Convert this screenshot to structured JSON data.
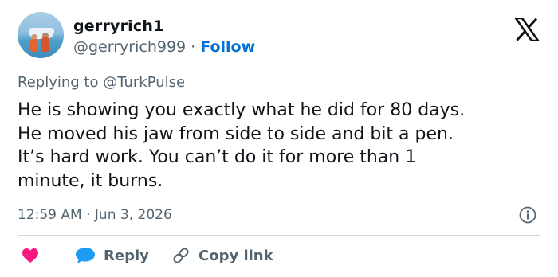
{
  "user": {
    "display_name": "gerryrich1",
    "handle": "@gerryrich999",
    "separator": " · ",
    "follow_label": "Follow"
  },
  "reply": {
    "prefix": "Replying to ",
    "target": "@TurkPulse"
  },
  "tweet": {
    "lines": [
      "He is showing you exactly what he did for 80 days.",
      "He moved his jaw from side to side and bit a pen.",
      "It’s hard work. You can’t do it for more than 1",
      "minute, it burns."
    ]
  },
  "meta": {
    "time": "12:59 AM",
    "separator": " · ",
    "date": "Jun 3, 2026"
  },
  "actions": {
    "reply_label": "Reply",
    "copy_label": "Copy link"
  },
  "icons": {
    "logo": "x-logo-icon",
    "info": "info-icon",
    "like": "heart-icon",
    "reply": "speech-bubble-icon",
    "copy": "link-icon"
  },
  "colors": {
    "text": "#0f1419",
    "muted": "#536471",
    "link": "#006fd6",
    "heart": "#f91880",
    "reply_bubble": "#1d9bf0",
    "divider": "#cfd9de"
  }
}
